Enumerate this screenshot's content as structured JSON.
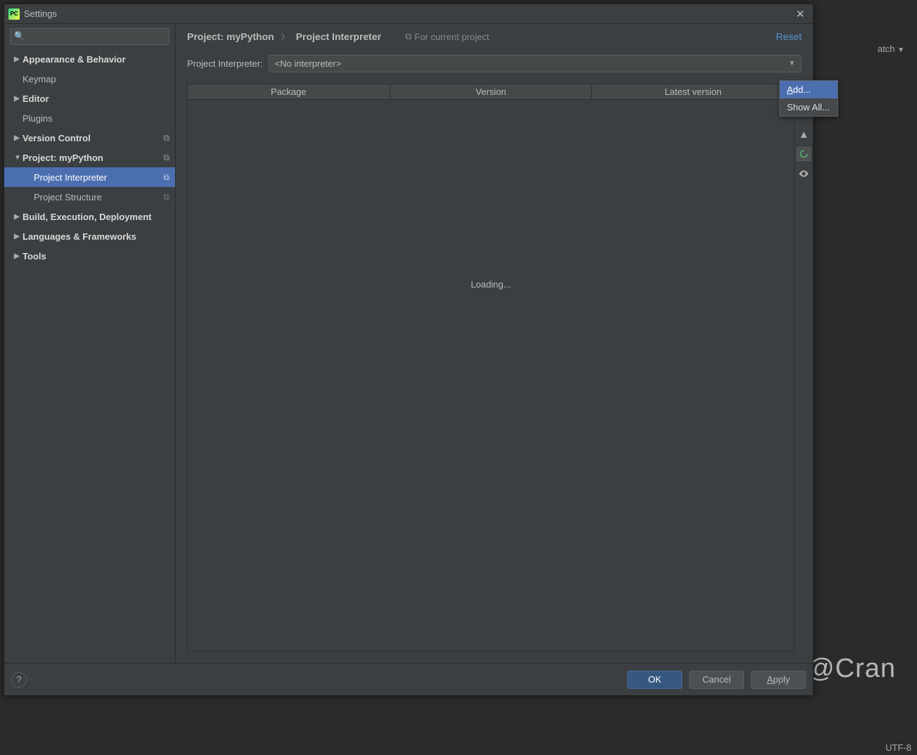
{
  "titlebar": {
    "title": "Settings"
  },
  "search": {
    "placeholder": ""
  },
  "tree": {
    "items": [
      {
        "label": "Appearance & Behavior",
        "expandable": true,
        "bold": true
      },
      {
        "label": "Keymap",
        "expandable": false
      },
      {
        "label": "Editor",
        "expandable": true,
        "bold": true
      },
      {
        "label": "Plugins",
        "expandable": false
      },
      {
        "label": "Version Control",
        "expandable": true,
        "bold": true,
        "copy": true
      },
      {
        "label": "Project: myPython",
        "expandable": true,
        "bold": true,
        "expanded": true,
        "copy": true
      },
      {
        "label": "Build, Execution, Deployment",
        "expandable": true,
        "bold": true
      },
      {
        "label": "Languages & Frameworks",
        "expandable": true,
        "bold": true
      },
      {
        "label": "Tools",
        "expandable": true,
        "bold": true
      }
    ],
    "project_children": [
      {
        "label": "Project Interpreter",
        "selected": true,
        "copy": true
      },
      {
        "label": "Project Structure",
        "copy": true
      }
    ]
  },
  "breadcrumbs": {
    "a": "Project: myPython",
    "b": "Project Interpreter",
    "for_project": "For current project",
    "reset": "Reset"
  },
  "interpreter": {
    "label": "Project Interpreter:",
    "value": "<No interpreter>"
  },
  "table": {
    "cols": [
      "Package",
      "Version",
      "Latest version"
    ],
    "loading": "Loading..."
  },
  "dropdown": {
    "add": "Add...",
    "show_all": "Show All..."
  },
  "footer": {
    "ok": "OK",
    "cancel": "Cancel",
    "apply": "Apply"
  },
  "side_icons": {
    "add": "add-icon",
    "remove": "remove-icon",
    "up": "up-icon",
    "refresh": "refresh-icon",
    "eye": "show-paths-icon"
  },
  "background": {
    "watch_label": "atch",
    "encoding": "UTF-8",
    "watermark": "知乎 @Cran"
  }
}
